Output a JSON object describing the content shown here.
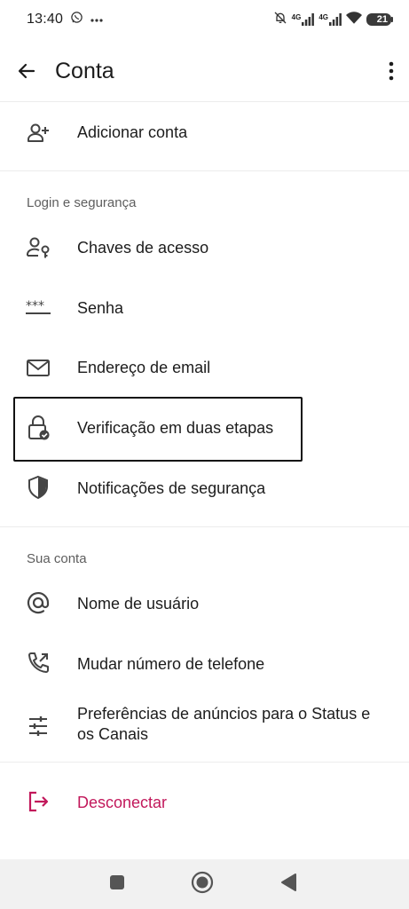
{
  "status_bar": {
    "time": "13:40",
    "signal_1_label": "4G",
    "signal_2_label": "4G",
    "battery": "21",
    "icons": [
      "whatsapp-icon",
      "more-dots-icon",
      "mute-icon",
      "signal-icon",
      "signal-icon",
      "wifi-icon",
      "battery-icon"
    ]
  },
  "app_bar": {
    "title": "Conta",
    "back_icon": "arrow-left-icon",
    "menu_icon": "more-vert-icon"
  },
  "items": {
    "add_account": {
      "label": "Adicionar conta",
      "icon": "person-add-icon"
    },
    "passkeys": {
      "label": "Chaves de acesso",
      "icon": "person-key-icon"
    },
    "password": {
      "label": "Senha",
      "icon": "password-dots-icon"
    },
    "email": {
      "label": "Endereço de email",
      "icon": "mail-icon"
    },
    "two_step": {
      "label": "Verificação em duas etapas",
      "icon": "lock-check-icon"
    },
    "security_notifications": {
      "label": "Notificações de segurança",
      "icon": "shield-icon"
    },
    "username": {
      "label": "Nome de usuário",
      "icon": "at-icon"
    },
    "change_number": {
      "label": "Mudar número de telefone",
      "icon": "phone-forward-icon"
    },
    "ad_preferences": {
      "label": "Preferências de anúncios para o Status e os Canais",
      "icon": "sliders-icon"
    },
    "logout": {
      "label": "Desconectar",
      "icon": "logout-icon",
      "color": "#c2185b"
    }
  },
  "sections": {
    "login_security": "Login e segurança",
    "your_account": "Sua conta"
  },
  "nav_bar": {
    "icons": [
      "recents-square-icon",
      "home-circle-icon",
      "back-triangle-icon"
    ]
  }
}
